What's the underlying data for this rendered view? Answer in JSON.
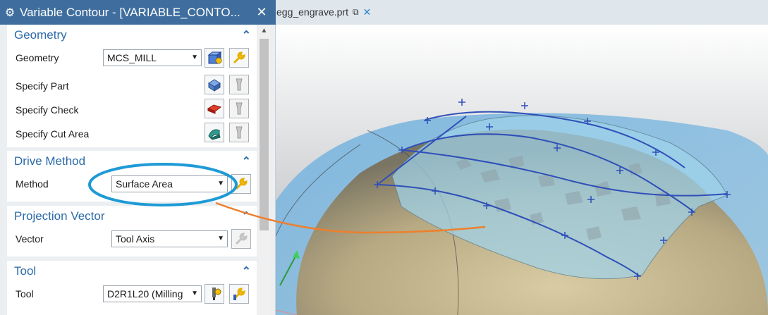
{
  "window": {
    "dialog_title": "Variable Contour - [VARIABLE_CONTO...",
    "file_tab": "egg_engrave.prt"
  },
  "geometry": {
    "title": "Geometry",
    "geometry_label": "Geometry",
    "geometry_value": "MCS_MILL",
    "specify_part": "Specify Part",
    "specify_check": "Specify Check",
    "specify_cut_area": "Specify Cut Area"
  },
  "drive_method": {
    "title": "Drive Method",
    "method_label": "Method",
    "method_value": "Surface Area"
  },
  "projection_vector": {
    "title": "Projection Vector",
    "vector_label": "Vector",
    "vector_value": "Tool Axis"
  },
  "tool": {
    "title": "Tool",
    "tool_label": "Tool",
    "tool_value": "D2R1L20 (Milling"
  },
  "colors": {
    "dialog_tab": "#3f6e9e",
    "group_title": "#2b6aa8",
    "annotation_ellipse": "#1e9ad6",
    "annotation_arrow": "#ee7f2d",
    "drive_curve": "#2f4fb8"
  }
}
